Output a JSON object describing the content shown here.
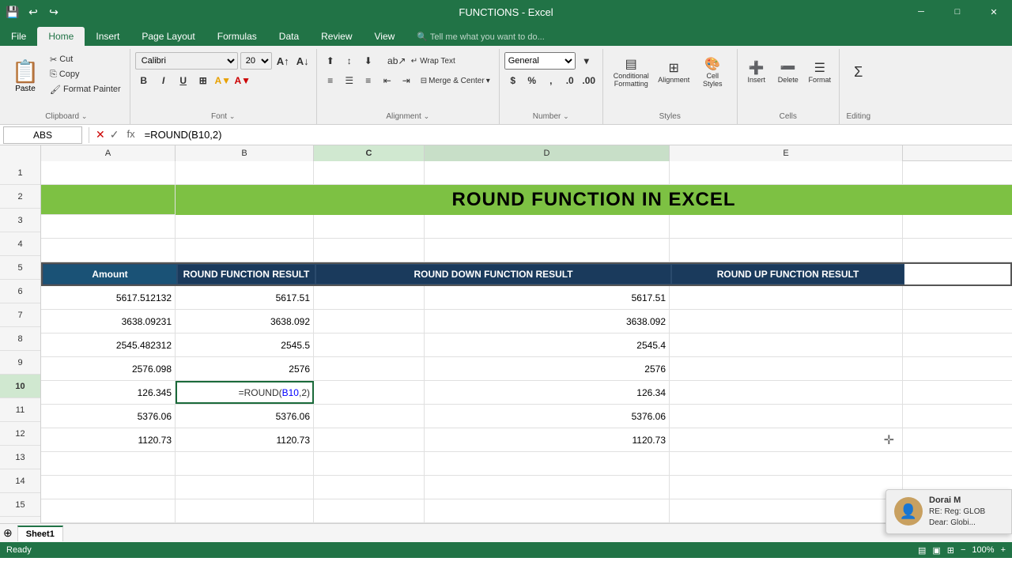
{
  "titleBar": {
    "title": "FUNCTIONS - Excel",
    "saveIcon": "💾",
    "undoIcon": "↩",
    "redoIcon": "↪"
  },
  "tabs": [
    {
      "label": "File",
      "active": false
    },
    {
      "label": "Home",
      "active": true
    },
    {
      "label": "Insert",
      "active": false
    },
    {
      "label": "Page Layout",
      "active": false
    },
    {
      "label": "Formulas",
      "active": false
    },
    {
      "label": "Data",
      "active": false
    },
    {
      "label": "Review",
      "active": false
    },
    {
      "label": "View",
      "active": false
    },
    {
      "label": "Tell me what you want to do...",
      "active": false
    }
  ],
  "ribbon": {
    "clipboard": {
      "paste_label": "Paste",
      "cut_label": "Cut",
      "copy_label": "Copy",
      "format_painter_label": "Format Painter"
    },
    "font": {
      "name": "Calibri",
      "size": "20",
      "bold": "B",
      "italic": "I",
      "underline": "U"
    },
    "alignment": {
      "wrap_text": "Wrap Text",
      "merge_center": "Merge & Center"
    },
    "number": {
      "format": "General"
    },
    "groups": [
      {
        "label": "Clipboard"
      },
      {
        "label": "Font"
      },
      {
        "label": "Alignment"
      },
      {
        "label": "Number"
      },
      {
        "label": "Styles"
      },
      {
        "label": "Cells"
      },
      {
        "label": "Editing"
      }
    ]
  },
  "formulaBar": {
    "nameBox": "ABS",
    "formula": "=ROUND(B10,2)"
  },
  "columns": [
    {
      "label": "",
      "id": "corner"
    },
    {
      "label": "A",
      "id": "A"
    },
    {
      "label": "B",
      "id": "B"
    },
    {
      "label": "C",
      "id": "C",
      "active": true
    },
    {
      "label": "D",
      "id": "D"
    },
    {
      "label": "E",
      "id": "E"
    }
  ],
  "rows": [
    1,
    2,
    3,
    4,
    5,
    6,
    7,
    8,
    9,
    10,
    11,
    12,
    13,
    14,
    15
  ],
  "titleText": "ROUND FUNCTION IN EXCEL",
  "headers": {
    "amount": "Amount",
    "round": "ROUND FUNCTION RESULT",
    "roundDown": "ROUND DOWN FUNCTION RESULT",
    "roundUp": "ROUND UP FUNCTION RESULT"
  },
  "tableData": [
    {
      "amount": "5617.512132",
      "round": "5617.51",
      "roundDown": "5617.51",
      "roundUp": ""
    },
    {
      "amount": "3638.09231",
      "round": "3638.092",
      "roundDown": "3638.092",
      "roundUp": ""
    },
    {
      "amount": "2545.482312",
      "round": "2545.5",
      "roundDown": "2545.4",
      "roundUp": ""
    },
    {
      "amount": "2576.098",
      "round": "2576",
      "roundDown": "2576",
      "roundUp": ""
    },
    {
      "amount": "126.345",
      "round": "=ROUND(B10,2)",
      "roundDown": "126.34",
      "roundUp": ""
    },
    {
      "amount": "5376.06",
      "round": "5376.06",
      "roundDown": "5376.06",
      "roundUp": ""
    },
    {
      "amount": "1120.73",
      "round": "1120.73",
      "roundDown": "1120.73",
      "roundUp": ""
    }
  ],
  "sheetTabs": [
    {
      "label": "Sheet1",
      "active": true
    }
  ],
  "statusBar": {
    "left": "Ready",
    "right": "RE: Reg: GLOB"
  },
  "toast": {
    "name": "Dorai M",
    "subtext": "RE: Reg: GLOB\nDear: Globi..."
  }
}
